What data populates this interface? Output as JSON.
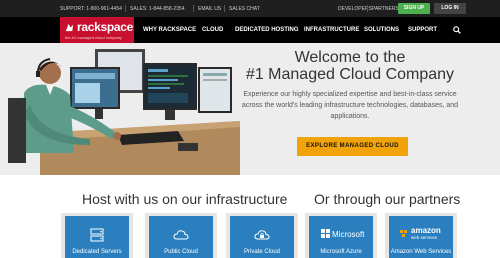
{
  "utility_bar": {
    "support": "SUPPORT: 1-800-961-4454",
    "sales": "SALES: 1-844-858-2354",
    "email": "EMAIL US",
    "chat": "SALES CHAT",
    "developers": "DEVELOPERS",
    "partners": "PARTNERS",
    "signup": "SIGN UP",
    "login": "LOG IN"
  },
  "logo": {
    "wordmark": "rackspace",
    "tagline": "the #1 managed cloud company"
  },
  "nav": {
    "items": [
      "WHY RACKSPACE",
      "CLOUD",
      "DEDICATED HOSTING",
      "INFRASTRUCTURE",
      "SOLUTIONS",
      "SUPPORT"
    ]
  },
  "hero": {
    "title_line1": "Welcome to the",
    "title_line2": "#1 Managed Cloud Company",
    "subtitle": "Experience our highly specialized expertise and best-in-class service across the world's leading infrastructure technologies, databases, and applications.",
    "cta": "EXPLORE MANAGED CLOUD"
  },
  "infra": {
    "title": "Host with us on our infrastructure",
    "cards": [
      "Dedicated Servers",
      "Public Cloud",
      "Private Cloud"
    ]
  },
  "partners": {
    "title": "Or through our partners",
    "cards": [
      "Microsoft Azure",
      "Amazon Web Services"
    ],
    "microsoft_text": "Microsoft",
    "amazon_text": "amazon",
    "amazon_sub": "web services"
  },
  "colors": {
    "brand_red": "#c8102e",
    "signup_green": "#4caf50",
    "cta_orange": "#f0a30a",
    "card_blue": "#2b7fbf"
  },
  "icons": [
    "search-icon",
    "server-icon",
    "cloud-icon",
    "lock-cloud-icon",
    "microsoft-logo",
    "amazon-logo"
  ]
}
